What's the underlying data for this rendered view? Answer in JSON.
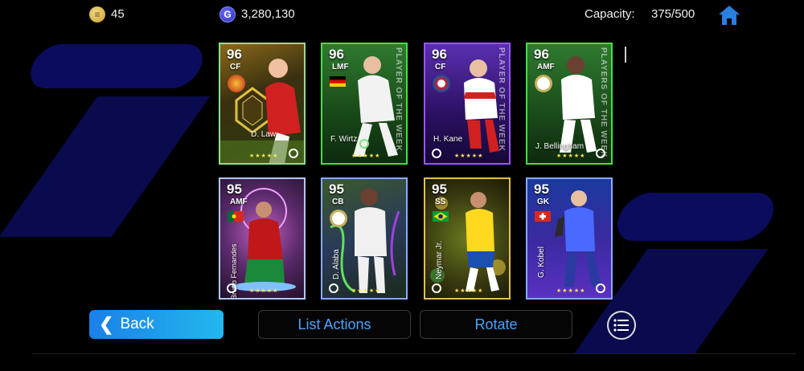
{
  "topbar": {
    "coins": "45",
    "gp": "3,280,130",
    "capacity_label": "Capacity:",
    "capacity_value": "375/500",
    "coin_icon_glyph": "≡",
    "gp_icon_glyph": "G"
  },
  "cards": [
    {
      "rating": "96",
      "position": "CF",
      "name": "D. Law",
      "border": "#7be07b",
      "bg": "#5a4a1a"
    },
    {
      "rating": "96",
      "position": "LMF",
      "name": "F. Wirtz",
      "border": "#44e044",
      "bg": "#1f5a1f",
      "potw": "PLAYER OF THE WEEK"
    },
    {
      "rating": "96",
      "position": "CF",
      "name": "H. Kane",
      "border": "#9a55ff",
      "bg": "#3c1f7a",
      "potw": "PLAYER OF THE WEEK"
    },
    {
      "rating": "96",
      "position": "AMF",
      "name": "J. Bellingham",
      "border": "#44e044",
      "bg": "#1f5a1f",
      "potw": "PLAYERS OF THE WEEK"
    },
    {
      "rating": "95",
      "position": "AMF",
      "name": "Bruno Fernandes",
      "border": "#b0c8ff",
      "bg": "#6a3a6a"
    },
    {
      "rating": "95",
      "position": "CB",
      "name": "D. Alaba",
      "border": "#88aaff",
      "bg": "#2a3a2a"
    },
    {
      "rating": "95",
      "position": "SS",
      "name": "Neymar Jr.",
      "border": "#e0c050",
      "bg": "#3a3a10"
    },
    {
      "rating": "95",
      "position": "GK",
      "name": "G. Kobel",
      "border": "#88aaff",
      "bg": "#3a3aa0"
    }
  ],
  "buttons": {
    "back": "Back",
    "list_actions": "List Actions",
    "rotate": "Rotate",
    "back_chevron": "❮"
  },
  "stars": "★★★★★"
}
